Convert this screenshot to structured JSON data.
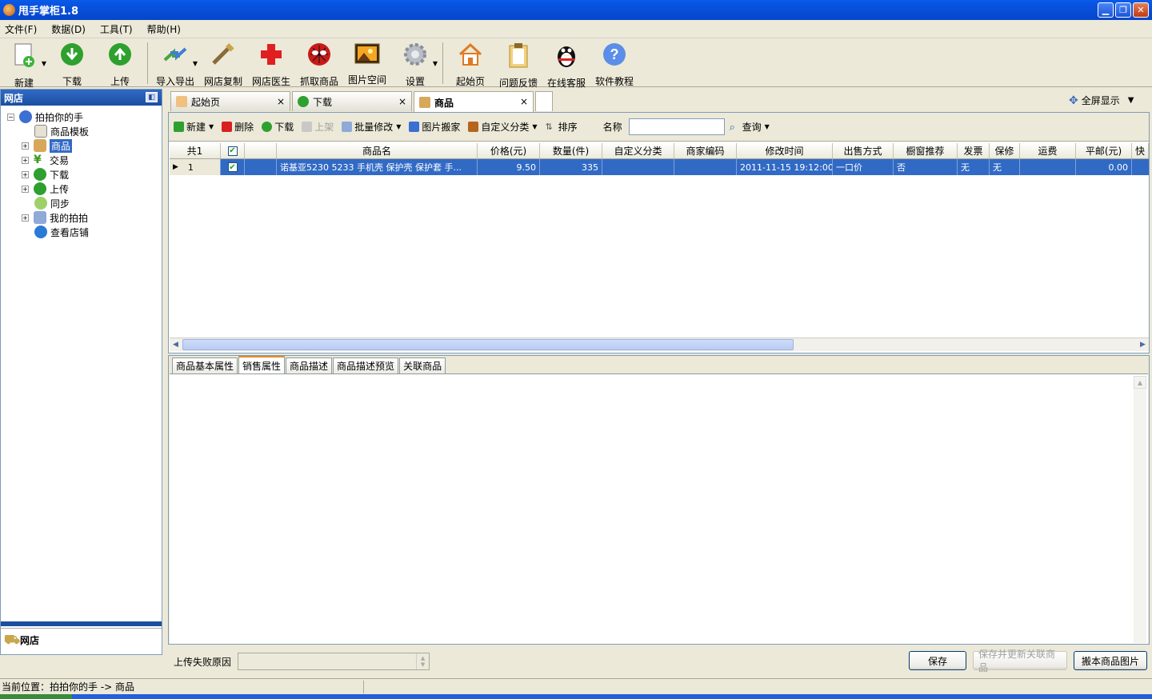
{
  "window": {
    "title": "甩手掌柜1.8"
  },
  "menu": [
    "文件(F)",
    "数据(D)",
    "工具(T)",
    "帮助(H)"
  ],
  "toolbar": {
    "new": "新建",
    "download": "下载",
    "upload": "上传",
    "import_export": "导入导出",
    "copy_shop": "网店复制",
    "shop_doctor": "网店医生",
    "grab": "抓取商品",
    "image_space": "图片空间",
    "settings": "设置",
    "home": "起始页",
    "feedback": "问题反馈",
    "online_service": "在线客服",
    "tutorial": "软件教程"
  },
  "sidebar": {
    "title": "网店",
    "root": "拍拍你的手",
    "items": [
      "商品模板",
      "商品",
      "交易",
      "下载",
      "上传",
      "同步",
      "我的拍拍",
      "查看店铺"
    ],
    "footer": "网店"
  },
  "tabs": [
    "起始页",
    "下载",
    "商品"
  ],
  "fullscreen": "全屏显示",
  "item_toolbar": {
    "new": "新建",
    "delete": "删除",
    "download": "下载",
    "shelve": "上架",
    "batch_edit": "批量修改",
    "image_move": "图片搬家",
    "custom_category": "自定义分类",
    "sort": "排序",
    "name_label": "名称",
    "search": "查询"
  },
  "grid": {
    "total": "共1",
    "headers": [
      "商品名",
      "价格(元)",
      "数量(件)",
      "自定义分类",
      "商家编码",
      "修改时间",
      "出售方式",
      "橱窗推荐",
      "发票",
      "保修",
      "运费",
      "平邮(元)",
      "快"
    ],
    "rows": [
      {
        "index": "1",
        "name": "诺基亚5230 5233 手机壳 保护壳 保护套 手...",
        "price": "9.50",
        "qty": "335",
        "custom_cat": "",
        "code": "",
        "modified": "2011-11-15 19:12:00",
        "sale_type": "一口价",
        "window": "否",
        "invoice": "无",
        "warranty": "无",
        "shipping": "",
        "mail_fee": "0.00"
      }
    ]
  },
  "detail_tabs": [
    "商品基本属性",
    "销售属性",
    "商品描述",
    "商品描述预览",
    "关联商品"
  ],
  "bottom": {
    "fail_reason": "上传失败原因",
    "save": "保存",
    "save_update": "保存并更新关联商品",
    "move_images": "搬本商品图片"
  },
  "status": "当前位置：拍拍你的手 -> 商品"
}
